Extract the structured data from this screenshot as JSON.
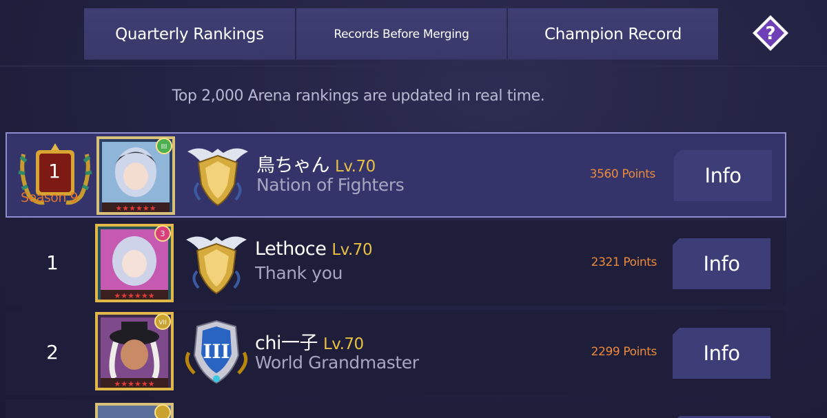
{
  "tabs": [
    {
      "label": "Quarterly Rankings"
    },
    {
      "label": "Records Before Merging"
    },
    {
      "label": "Champion Record"
    }
  ],
  "help_icon": "question-diamond-icon",
  "notice": "Top 2,000 Arena rankings are updated in real time.",
  "rankings": [
    {
      "rank": "1",
      "season_label": "Season 9",
      "name": "鳥ちゃん",
      "level": "Lv.70",
      "guild": "Nation of Fighters",
      "points": "3560 Points",
      "info_label": "Info",
      "portrait_badge": "III",
      "badge_color": "#4caf50",
      "emblem": "gold-winged-shield-icon"
    },
    {
      "rank": "1",
      "name": "Lethoce",
      "level": "Lv.70",
      "guild": "Thank you",
      "points": "2321 Points",
      "info_label": "Info",
      "portrait_badge": "3",
      "badge_color": "#d9407a",
      "emblem": "gold-winged-shield-icon"
    },
    {
      "rank": "2",
      "name": "chi一子",
      "level": "Lv.70",
      "guild": "World Grandmaster",
      "points": "2299 Points",
      "info_label": "Info",
      "portrait_badge": "VII",
      "badge_color": "#c9a230",
      "emblem": "blue-rank-iii-shield-icon"
    }
  ],
  "colors": {
    "accent_level": "#e8c143",
    "points": "#ec8a3b",
    "button": "#3d3d78",
    "highlight_row": "#34346a"
  }
}
